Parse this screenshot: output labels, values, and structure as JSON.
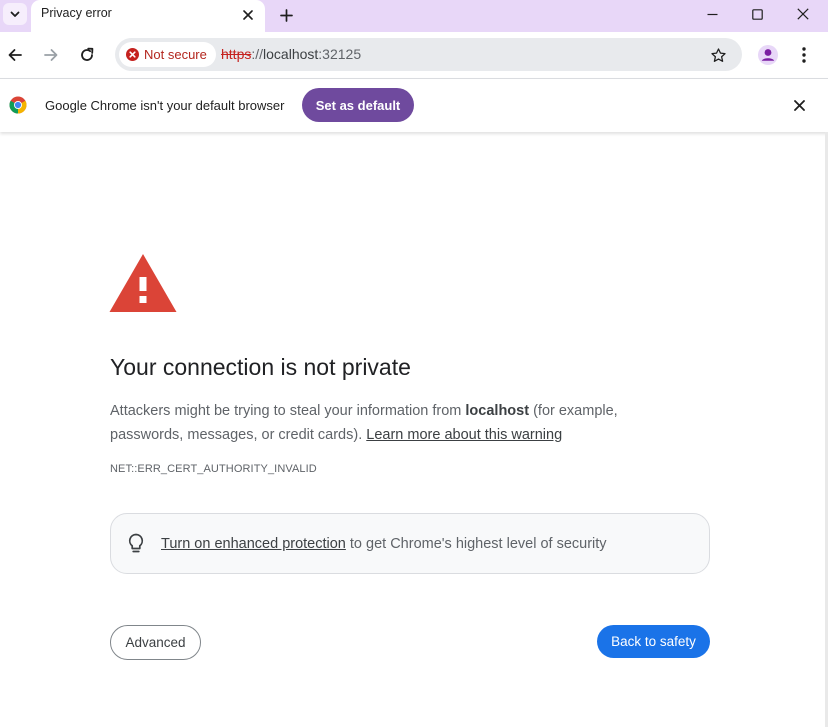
{
  "tab": {
    "title": "Privacy error",
    "search_icon": "chevron-down-icon",
    "close_icon": "close-icon",
    "new_tab_icon": "plus-icon"
  },
  "window_controls": {
    "minimize_icon": "minimize-icon",
    "maximize_icon": "maximize-icon",
    "close_icon": "close-icon"
  },
  "toolbar": {
    "back_icon": "arrow-left-icon",
    "forward_icon": "arrow-right-icon",
    "reload_icon": "reload-icon",
    "security_chip": "Not secure",
    "url_scheme": "https",
    "url_sep": "://",
    "url_host": "localhost",
    "url_port": ":32125",
    "bookmark_icon": "star-icon",
    "profile_icon": "profile-icon",
    "menu_icon": "kebab-menu-icon"
  },
  "infobar": {
    "message": "Google Chrome isn't your default browser",
    "button_label": "Set as default",
    "close_icon": "close-icon"
  },
  "interstitial": {
    "heading": "Your connection is not private",
    "desc_before": "Attackers might be trying to steal your information from ",
    "desc_host": "localhost",
    "desc_after": " (for example, passwords, messages, or credit cards). ",
    "learn_more": "Learn more about this warning",
    "error_code": "NET::ERR_CERT_AUTHORITY_INVALID",
    "enhanced_link": "Turn on enhanced protection",
    "enhanced_rest": " to get Chrome's highest level of security",
    "advanced_label": "Advanced",
    "back_label": "Back to safety"
  },
  "colors": {
    "tabstrip": "#e8d7f8",
    "accent_purple": "#6f4a9e",
    "danger_red": "#c5221f",
    "primary_blue": "#1a73e8",
    "warning_red": "#db4437"
  }
}
